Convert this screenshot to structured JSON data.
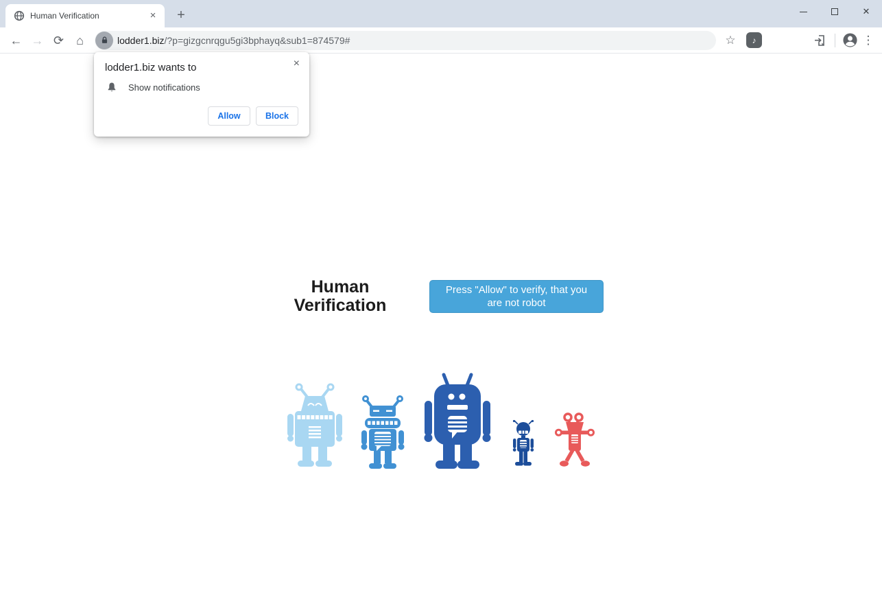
{
  "window": {
    "controls": {
      "close_icon": "✕"
    }
  },
  "tab": {
    "title": "Human Verification"
  },
  "toolbar": {
    "url_domain": "lodder1.biz",
    "url_path": "/?p=gizgcnrqgu5gi3bphayq&sub1=874579#"
  },
  "icons": {
    "back": "←",
    "forward": "→",
    "reload": "⟳",
    "home": "⌂",
    "star": "☆",
    "menu": "⋮",
    "close": "×",
    "plus": "+",
    "music_note": "♪"
  },
  "permission_dialog": {
    "title": "lodder1.biz wants to",
    "request": "Show notifications",
    "allow_label": "Allow",
    "block_label": "Block",
    "close_icon": "×"
  },
  "main": {
    "heading": "Human Verification",
    "cta_label": "Press \"Allow\" to verify, that you are not robot"
  },
  "robots": [
    {
      "name": "light-blue-robot",
      "color": "#a9d7f2"
    },
    {
      "name": "medium-blue-robot",
      "color": "#4191d3"
    },
    {
      "name": "large-blue-robot",
      "color": "#2c5faf"
    },
    {
      "name": "small-navy-robot",
      "color": "#1c4d9a"
    },
    {
      "name": "red-robot",
      "color": "#e85a5a"
    }
  ],
  "colors": {
    "titlebar": "#d6dee9",
    "accent": "#48a5da",
    "link-blue": "#1a73e8"
  }
}
